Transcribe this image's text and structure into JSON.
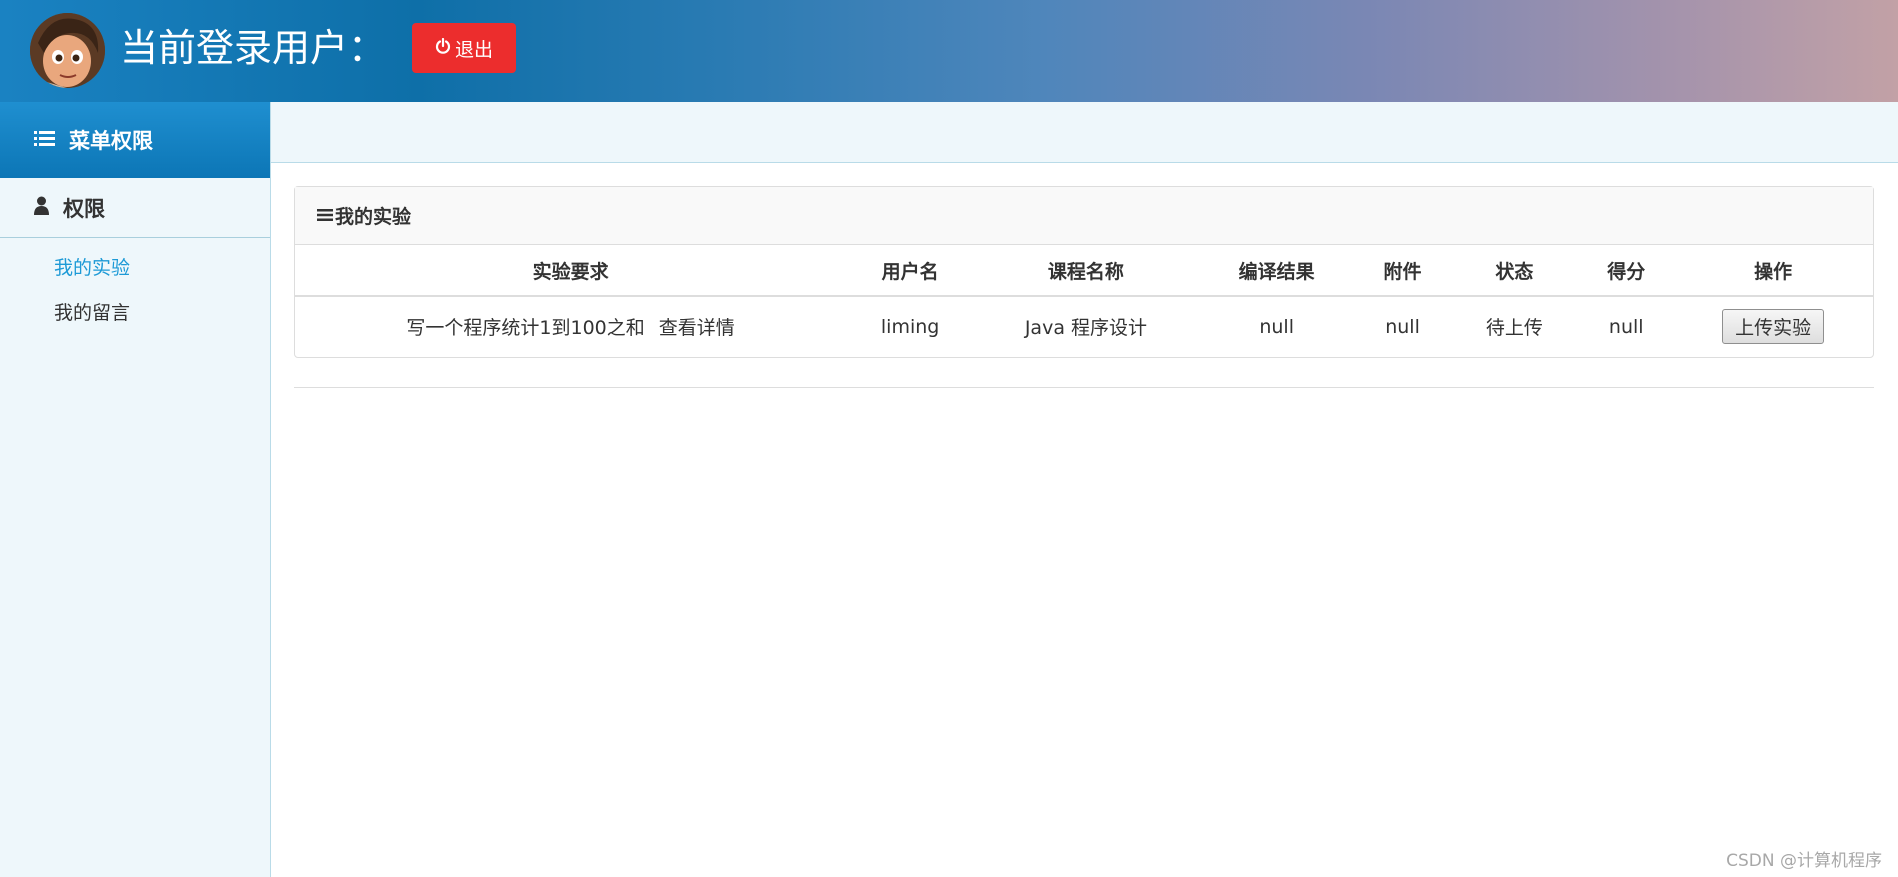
{
  "header": {
    "title": "当前登录用户：",
    "logout_label": "退出"
  },
  "sidebar": {
    "menu_title": "菜单权限",
    "group_title": "权限",
    "items": [
      {
        "label": "我的实验",
        "active": true
      },
      {
        "label": "我的留言",
        "active": false
      }
    ]
  },
  "panel": {
    "title": "我的实验",
    "columns": [
      "实验要求",
      "用户名",
      "课程名称",
      "编译结果",
      "附件",
      "状态",
      "得分",
      "操作"
    ],
    "rows": [
      {
        "requirement": "写一个程序统计1到100之和",
        "detail_link": "查看详情",
        "username": "liming",
        "course": "Java 程序设计",
        "compile_result": "null",
        "attachment": "null",
        "status": "待上传",
        "score": "null",
        "action": "上传实验"
      }
    ]
  },
  "watermark": "CSDN @计算机程序",
  "colors": {
    "accent": "#1d9ad6",
    "logout": "#ec2d2d",
    "sidebar_bg": "#eef7fb"
  }
}
